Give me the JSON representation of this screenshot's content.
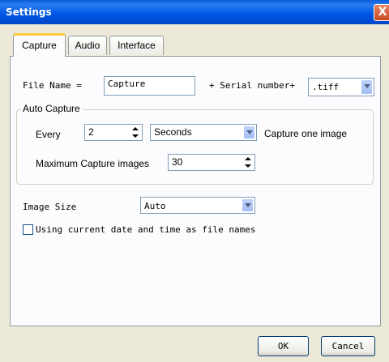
{
  "window": {
    "title": "Settings",
    "close_glyph": "X"
  },
  "tabs": [
    {
      "label": "Capture",
      "active": true
    },
    {
      "label": "Audio",
      "active": false
    },
    {
      "label": "Interface",
      "active": false
    }
  ],
  "capture": {
    "file_name_label": "File Name =",
    "file_name_value": "Capture",
    "serial_label": "+ Serial number+",
    "extension_value": ".tiff",
    "auto_capture": {
      "group_label": "Auto Capture",
      "every_label": "Every",
      "every_value": "2",
      "unit_value": "Seconds",
      "capture_one_label": "Capture one image",
      "max_label": "Maximum Capture images",
      "max_value": "30"
    },
    "image_size_label": "Image Size",
    "image_size_value": "Auto",
    "date_checkbox_label": "Using current date and time as file names",
    "date_checkbox_checked": false
  },
  "buttons": {
    "ok": "OK",
    "cancel": "Cancel"
  },
  "colors": {
    "titlebar": "#0058e6",
    "dialog_bg": "#ece9d8",
    "panel_bg": "#fcfcfe",
    "active_tab_accent": "#ffc83c"
  }
}
